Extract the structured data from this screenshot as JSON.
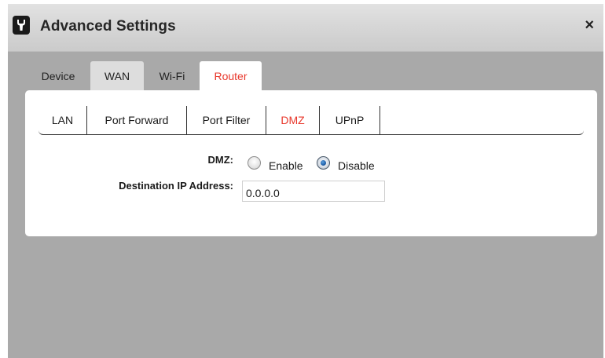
{
  "dialog": {
    "title": "Advanced Settings",
    "title_icon": "wrench-icon",
    "close_label": "×"
  },
  "tabs": [
    {
      "label": "Device",
      "state": "plain"
    },
    {
      "label": "WAN",
      "state": "inactive"
    },
    {
      "label": "Wi-Fi",
      "state": "plain"
    },
    {
      "label": "Router",
      "state": "active"
    }
  ],
  "subtabs": [
    {
      "label": "LAN"
    },
    {
      "label": "Port Forward"
    },
    {
      "label": "Port Filter"
    },
    {
      "label": "DMZ",
      "active": true
    },
    {
      "label": "UPnP"
    }
  ],
  "form": {
    "dmz_label": "DMZ:",
    "enable_label": "Enable",
    "disable_label": "Disable",
    "dmz_selected": "Disable",
    "ip_label": "Destination IP Address:",
    "ip_value": "0.0.0.0"
  },
  "colors": {
    "accent": "#e8372b",
    "background": "#a9a9a9",
    "panel": "#ffffff"
  }
}
